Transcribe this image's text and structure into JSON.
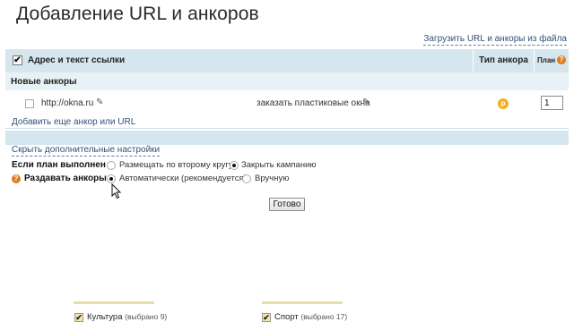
{
  "page": {
    "title": "Добавление URL и анкоров",
    "upload_link": "Загрузить URL и анкоры из файла"
  },
  "table": {
    "header": {
      "address_label": "Адрес и текст ссылки",
      "type_label": "Тип анкора",
      "plan_label": "План"
    },
    "section_label": "Новые анкоры",
    "rows": [
      {
        "url": "http://okna.ru",
        "anchor": "заказать пластиковые окна",
        "type_badge": "р",
        "plan_value": "1"
      }
    ],
    "add_link": "Добавить еще анкор или URL"
  },
  "settings": {
    "toggle_link": "Скрыть дополнительные настройки",
    "plan_done": {
      "label": "Если план выполнен",
      "options": [
        "Размещать по второму кругу",
        "Закрыть кампанию"
      ],
      "selected": "Закрыть кампанию"
    },
    "distribute": {
      "label": "Раздавать анкоры",
      "options": [
        "Автоматически (рекомендуется)",
        "Вручную"
      ],
      "selected": "Автоматически (рекомендуется)"
    },
    "done_button": "Готово"
  },
  "categories": [
    {
      "name": "Культура",
      "count": "(выбрано 9)"
    },
    {
      "name": "Спорт",
      "count": "(выбрано 17)"
    }
  ],
  "colors": {
    "accent_link": "#33507a",
    "header_band": "#d6e6ee",
    "help_icon": "#e07b1f",
    "type_badge": "#f2b11c"
  }
}
